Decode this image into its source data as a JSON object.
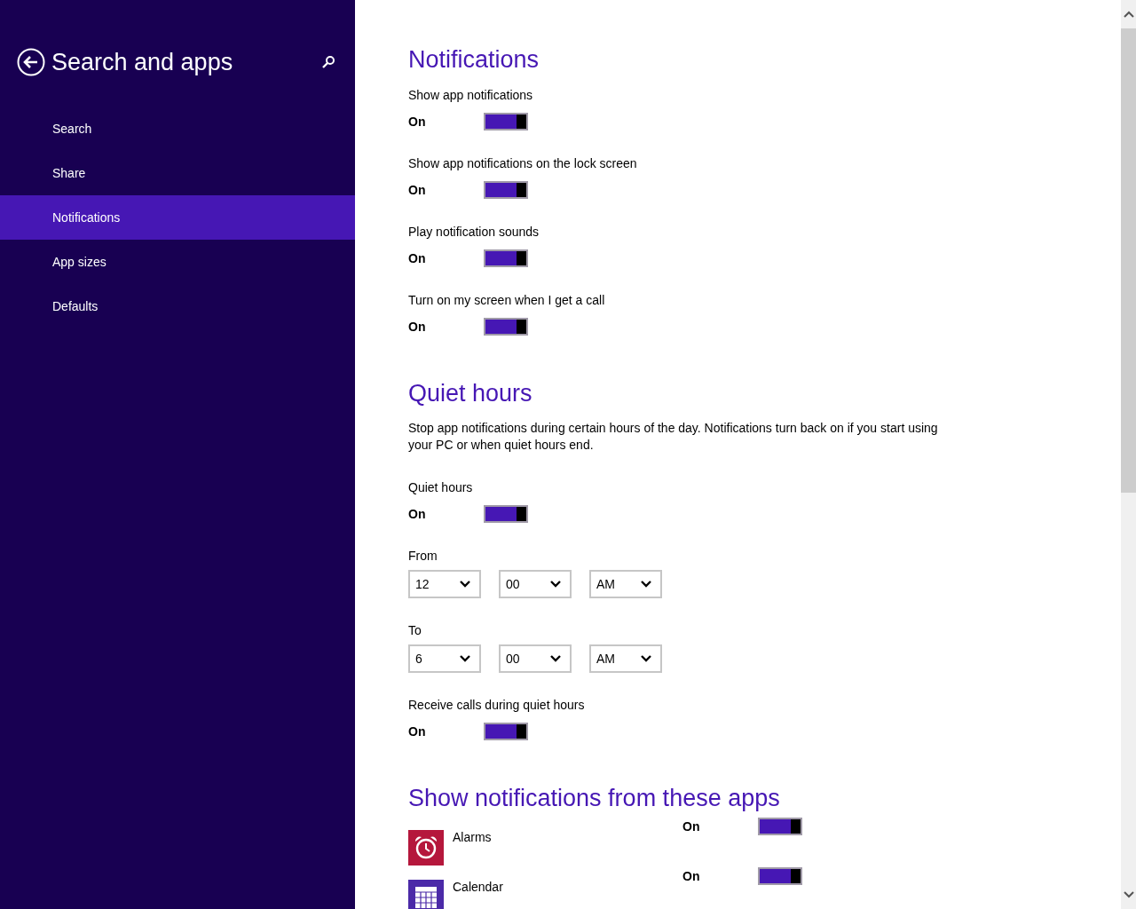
{
  "header": {
    "title": "Search and apps"
  },
  "sidebar": {
    "items": [
      {
        "label": "Search",
        "selected": false
      },
      {
        "label": "Share",
        "selected": false
      },
      {
        "label": "Notifications",
        "selected": true
      },
      {
        "label": "App sizes",
        "selected": false
      },
      {
        "label": "Defaults",
        "selected": false
      }
    ]
  },
  "sections": [
    {
      "heading": "Notifications",
      "items": [
        {
          "kind": "toggle",
          "label": "Show app notifications",
          "state_text": "On",
          "on": true
        },
        {
          "kind": "toggle",
          "label": "Show app notifications on the lock screen",
          "state_text": "On",
          "on": true
        },
        {
          "kind": "toggle",
          "label": "Play notification sounds",
          "state_text": "On",
          "on": true
        },
        {
          "kind": "toggle",
          "label": "Turn on my screen when I get a call",
          "state_text": "On",
          "on": true
        }
      ]
    },
    {
      "heading": "Quiet hours",
      "items": [
        {
          "kind": "text",
          "text": "Stop app notifications during certain hours of the day. Notifications turn back on if you start using your PC or when quiet hours end."
        },
        {
          "kind": "toggle",
          "label": "Quiet hours",
          "state_text": "On",
          "on": true
        },
        {
          "kind": "time",
          "label": "From",
          "fields": [
            "12",
            "00",
            "AM"
          ]
        },
        {
          "kind": "time",
          "label": "To",
          "fields": [
            "6",
            "00",
            "AM"
          ]
        },
        {
          "kind": "toggle",
          "label": "Receive calls during quiet hours",
          "state_text": "On",
          "on": true
        }
      ]
    },
    {
      "heading": "Show notifications from these apps",
      "items": [
        {
          "kind": "app",
          "name": "Alarms",
          "color": "#b5173c",
          "state_text": "On",
          "on": true
        },
        {
          "kind": "app",
          "name": "Calendar",
          "color": "#4b2aa8",
          "state_text": "On",
          "on": true
        }
      ]
    }
  ]
}
